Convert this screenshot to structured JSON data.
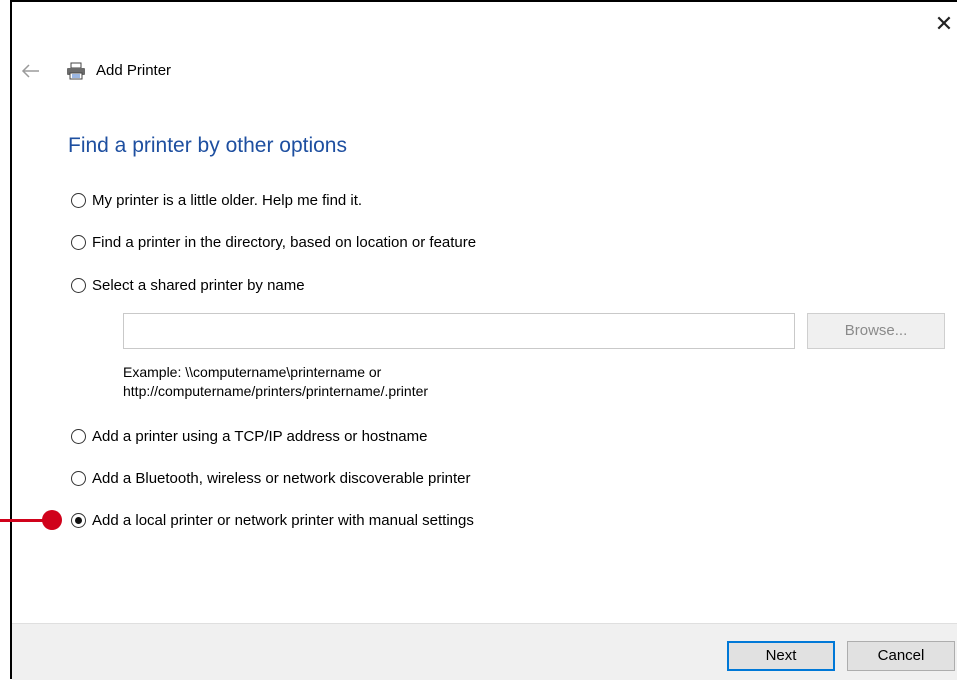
{
  "window": {
    "title": "Add Printer",
    "close_glyph": "✕",
    "icons": {
      "back": "back-arrow-icon",
      "printer": "printer-icon",
      "close": "close-icon"
    }
  },
  "heading": "Find a printer by other options",
  "options": [
    {
      "label": "My printer is a little older. Help me find it.",
      "checked": false
    },
    {
      "label": "Find a printer in the directory, based on location or feature",
      "checked": false
    },
    {
      "label": "Select a shared printer by name",
      "checked": false
    },
    {
      "label": "Add a printer using a TCP/IP address or hostname",
      "checked": false
    },
    {
      "label": "Add a Bluetooth, wireless or network discoverable printer",
      "checked": false
    },
    {
      "label": "Add a local printer or network printer with manual settings",
      "checked": true
    }
  ],
  "shared_printer": {
    "input_value": "",
    "browse_label": "Browse...",
    "example_line1": "Example: \\\\computername\\printername or",
    "example_line2": "http://computername/printers/printername/.printer"
  },
  "footer": {
    "next_label": "Next",
    "cancel_label": "Cancel"
  },
  "colors": {
    "heading": "#1e4fa0",
    "accent": "#0078d7",
    "annotation": "#d0021b"
  }
}
